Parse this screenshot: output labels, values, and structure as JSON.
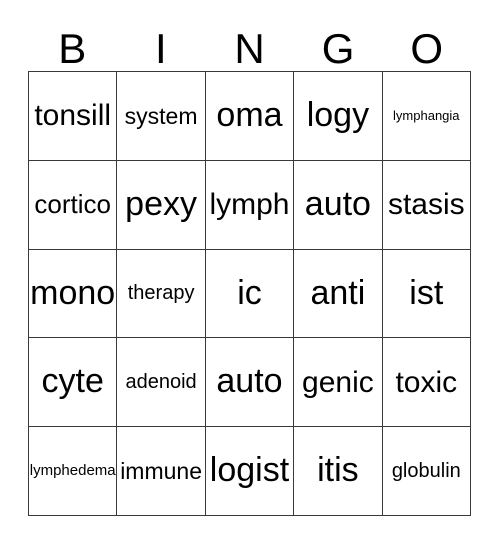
{
  "card": {
    "title": "BINGO",
    "header_letters": [
      "B",
      "I",
      "N",
      "G",
      "O"
    ],
    "columns": 5,
    "rows": 5,
    "colors": {
      "grid_line": "#3a3a3a",
      "cell_background": "#ffffff",
      "text": "#000000",
      "page_background": "#ffffff"
    },
    "cells": [
      [
        {
          "label": "tonsill",
          "size": "xl"
        },
        {
          "label": "system",
          "size": "ml"
        },
        {
          "label": "oma",
          "size": "xxl"
        },
        {
          "label": "logy",
          "size": "xxl"
        },
        {
          "label": "lymphangia",
          "size": "xs"
        }
      ],
      [
        {
          "label": "cortico",
          "size": "l"
        },
        {
          "label": "pexy",
          "size": "xxl"
        },
        {
          "label": "lymph",
          "size": "xl"
        },
        {
          "label": "auto",
          "size": "xxl"
        },
        {
          "label": "stasis",
          "size": "xl"
        }
      ],
      [
        {
          "label": "mono",
          "size": "xxl"
        },
        {
          "label": "therapy",
          "size": "m"
        },
        {
          "label": "ic",
          "size": "xxl"
        },
        {
          "label": "anti",
          "size": "xxl"
        },
        {
          "label": "ist",
          "size": "xxl"
        }
      ],
      [
        {
          "label": "cyte",
          "size": "xxl"
        },
        {
          "label": "adenoid",
          "size": "m"
        },
        {
          "label": "auto",
          "size": "xxl"
        },
        {
          "label": "genic",
          "size": "xl"
        },
        {
          "label": "toxic",
          "size": "xl"
        }
      ],
      [
        {
          "label": "lymphedema",
          "size": "s"
        },
        {
          "label": "immune",
          "size": "ml"
        },
        {
          "label": "logist",
          "size": "xxl"
        },
        {
          "label": "itis",
          "size": "xxl"
        },
        {
          "label": "globulin",
          "size": "m"
        }
      ]
    ]
  }
}
